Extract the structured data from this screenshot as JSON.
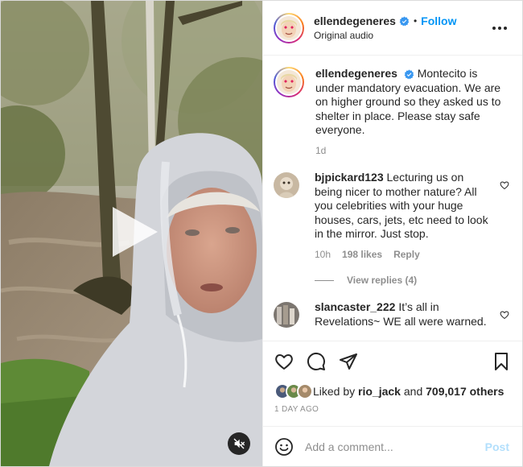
{
  "header": {
    "username": "ellendegeneres",
    "separator": "•",
    "follow_label": "Follow",
    "subtitle": "Original audio",
    "more_icon": "more-horizontal-icon"
  },
  "caption": {
    "username": "ellendegeneres",
    "text": "Montecito is under mandatory evacuation. We are on higher ground so they asked us to shelter in place. Please stay safe everyone.",
    "age": "1d"
  },
  "comments": [
    {
      "username": "bjpickard123",
      "text": "Lecturing us on being nicer to mother nature? All you celebrities with your huge houses, cars, jets, etc need to look in the mirror. Just stop.",
      "age": "10h",
      "likes": "198 likes",
      "reply_label": "Reply",
      "view_replies": "View replies (4)"
    },
    {
      "username": "slancaster_222",
      "text": "It’s all in Revelations~ WE all were warned."
    }
  ],
  "likes": {
    "prefix": "Liked by",
    "user": "rio_jack",
    "joiner": "and",
    "others": "709,017 others"
  },
  "timestamp": "1 DAY AGO",
  "add_comment": {
    "placeholder": "Add a comment...",
    "post_label": "Post"
  },
  "colors": {
    "accent": "#0095f6",
    "post_disabled": "#b2dffc",
    "muted": "#8e8e8e",
    "verified": "#3897f0"
  }
}
